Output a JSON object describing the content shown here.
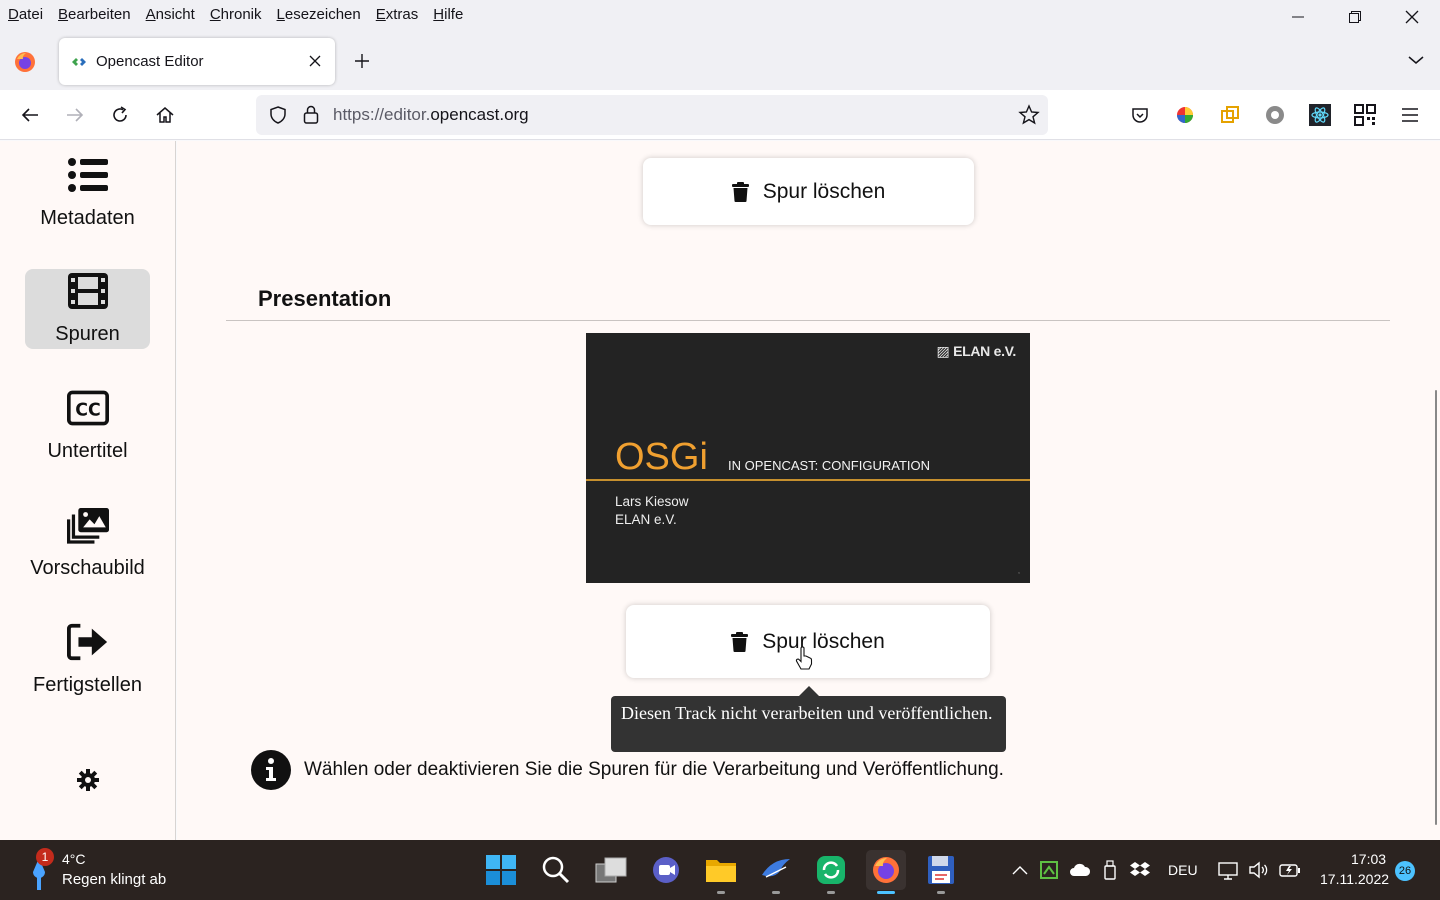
{
  "menubar": {
    "items": [
      "Datei",
      "Bearbeiten",
      "Ansicht",
      "Chronik",
      "Lesezeichen",
      "Extras",
      "Hilfe"
    ]
  },
  "browser": {
    "tab_title": "Opencast Editor",
    "url_prefix": "https://editor.",
    "url_domain": "opencast.org"
  },
  "sidebar": {
    "items": [
      {
        "label": "Metadaten",
        "icon": "list-icon"
      },
      {
        "label": "Spuren",
        "icon": "film-icon"
      },
      {
        "label": "Untertitel",
        "icon": "closed-caption-icon"
      },
      {
        "label": "Vorschaubild",
        "icon": "images-icon"
      },
      {
        "label": "Fertigstellen",
        "icon": "sign-out-icon"
      }
    ],
    "active_index": 1
  },
  "main": {
    "top_button_label": "Spur löschen",
    "section_title": "Presentation",
    "slide": {
      "brand": "ELAN e.V.",
      "title": "OSGi",
      "subtitle": "IN OPENCAST: CONFIGURATION",
      "author": "Lars Kiesow",
      "org": "ELAN e.V."
    },
    "delete_button_label": "Spur löschen",
    "tooltip": "Diesen Track nicht verarbeiten und veröffentlichen.",
    "info_text": "Wählen oder deaktivieren Sie die Spuren für die Verarbeitung und Veröffentlichung."
  },
  "taskbar": {
    "weather_badge": "1",
    "weather_temp": "4°C",
    "weather_desc": "Regen klingt ab",
    "language": "DEU",
    "time": "17:03",
    "date": "17.11.2022",
    "notification_count": "26"
  },
  "colors": {
    "accent_orange": "#f0a030",
    "active_tab_indicator": "#4cc2ff"
  }
}
